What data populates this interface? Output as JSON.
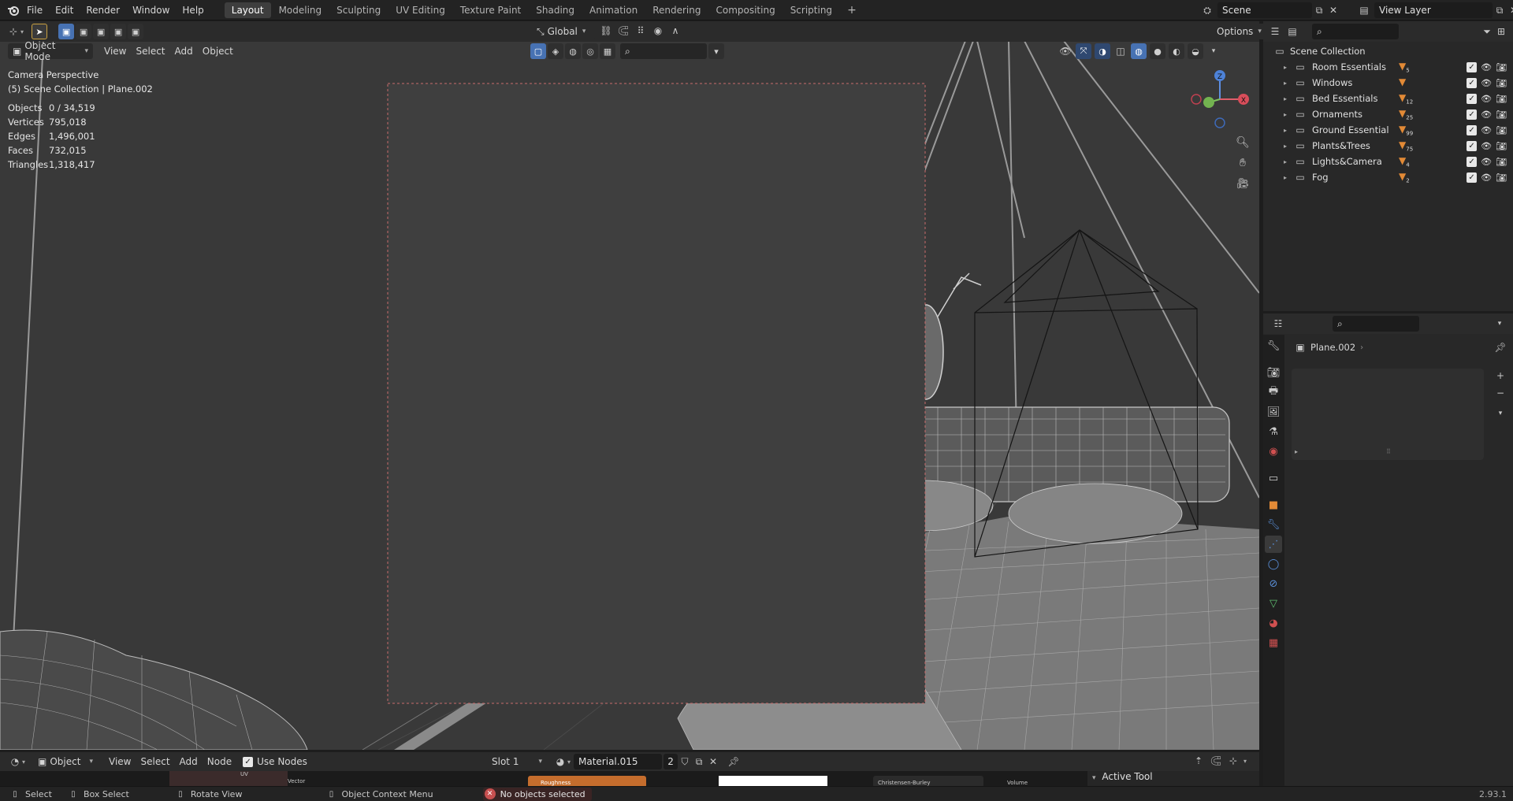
{
  "menus": [
    "File",
    "Edit",
    "Render",
    "Window",
    "Help"
  ],
  "workspaces": [
    "Layout",
    "Modeling",
    "Sculpting",
    "UV Editing",
    "Texture Paint",
    "Shading",
    "Animation",
    "Rendering",
    "Compositing",
    "Scripting"
  ],
  "active_workspace": "Layout",
  "scene": {
    "label": "Scene",
    "view_layer": "View Layer"
  },
  "viewport": {
    "mode": "Object Mode",
    "menu": [
      "View",
      "Select",
      "Add",
      "Object"
    ],
    "transform_orientation": "Global",
    "options_label": "Options",
    "title": "Camera Perspective",
    "subtitle": "(5) Scene Collection | Plane.002",
    "stats": [
      {
        "label": "Objects",
        "value": "0 / 34,519"
      },
      {
        "label": "Vertices",
        "value": "795,018"
      },
      {
        "label": "Edges",
        "value": "1,496,001"
      },
      {
        "label": "Faces",
        "value": "732,015"
      },
      {
        "label": "Triangles",
        "value": "1,318,417"
      }
    ],
    "gizmo_axes": [
      "X",
      "Y",
      "Z"
    ]
  },
  "outliner": {
    "root": "Scene Collection",
    "items": [
      {
        "label": "Room Essentials",
        "count": "5"
      },
      {
        "label": "Windows",
        "count": ""
      },
      {
        "label": "Bed Essentials",
        "count": "12"
      },
      {
        "label": "Ornaments",
        "count": "25"
      },
      {
        "label": "Ground Essential",
        "count": "99"
      },
      {
        "label": "Plants&Trees",
        "count": "75"
      },
      {
        "label": "Lights&Camera",
        "count": "4"
      },
      {
        "label": "Fog",
        "count": "2"
      }
    ],
    "lights_extra": [
      "3",
      "5"
    ]
  },
  "properties": {
    "object_name": "Plane.002",
    "tab_icons": [
      "tool-icon",
      "render-icon",
      "output-icon",
      "view-layer-icon",
      "scene-icon",
      "world-icon",
      "collection-icon",
      "object-icon",
      "modifier-icon",
      "particles-icon",
      "physics-icon",
      "constraints-icon",
      "data-icon",
      "material-icon",
      "texture-icon"
    ],
    "accent": "#e28a36"
  },
  "shader_editor": {
    "type": "Object",
    "menu": [
      "View",
      "Select",
      "Add",
      "Node"
    ],
    "use_nodes_label": "Use Nodes",
    "slot": "Slot 1",
    "material": "Material.015",
    "users": "2",
    "node_labels": [
      "UV",
      "Vector",
      "Roughness",
      "Christensen-Burley",
      "Volume"
    ],
    "active_tool_label": "Active Tool"
  },
  "status": {
    "select": "Select",
    "box_select": "Box Select",
    "rotate": "Rotate View",
    "context": "Object Context Menu",
    "message": "No objects selected",
    "version": "2.93.1"
  }
}
